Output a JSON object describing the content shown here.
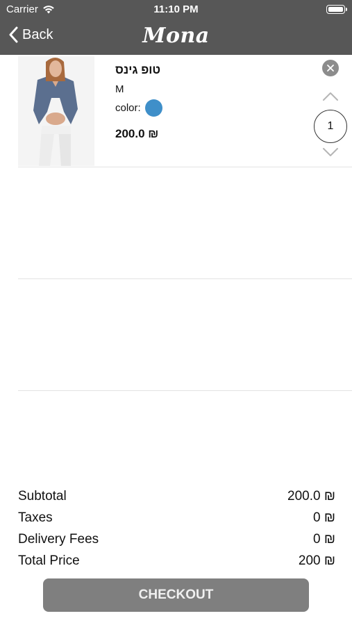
{
  "status_bar": {
    "carrier": "Carrier",
    "time": "11:10 PM"
  },
  "nav": {
    "back_label": "Back",
    "title": "Mona"
  },
  "cart": {
    "items": [
      {
        "name": "טופ גינס",
        "size": "M",
        "color_label": "color:",
        "color_hex": "#3f8fc9",
        "price": "200.0 ₪",
        "quantity": "1"
      }
    ]
  },
  "summary": {
    "subtotal_label": "Subtotal",
    "subtotal_value": "200.0 ₪",
    "taxes_label": "Taxes",
    "taxes_value": "0 ₪",
    "delivery_label": "Delivery Fees",
    "delivery_value": "0 ₪",
    "total_label": "Total Price",
    "total_value": "200 ₪"
  },
  "checkout_label": "CHECKOUT",
  "colors": {
    "navbar": "#575757",
    "checkout": "#7f7f7f",
    "swatch": "#3f8fc9"
  }
}
